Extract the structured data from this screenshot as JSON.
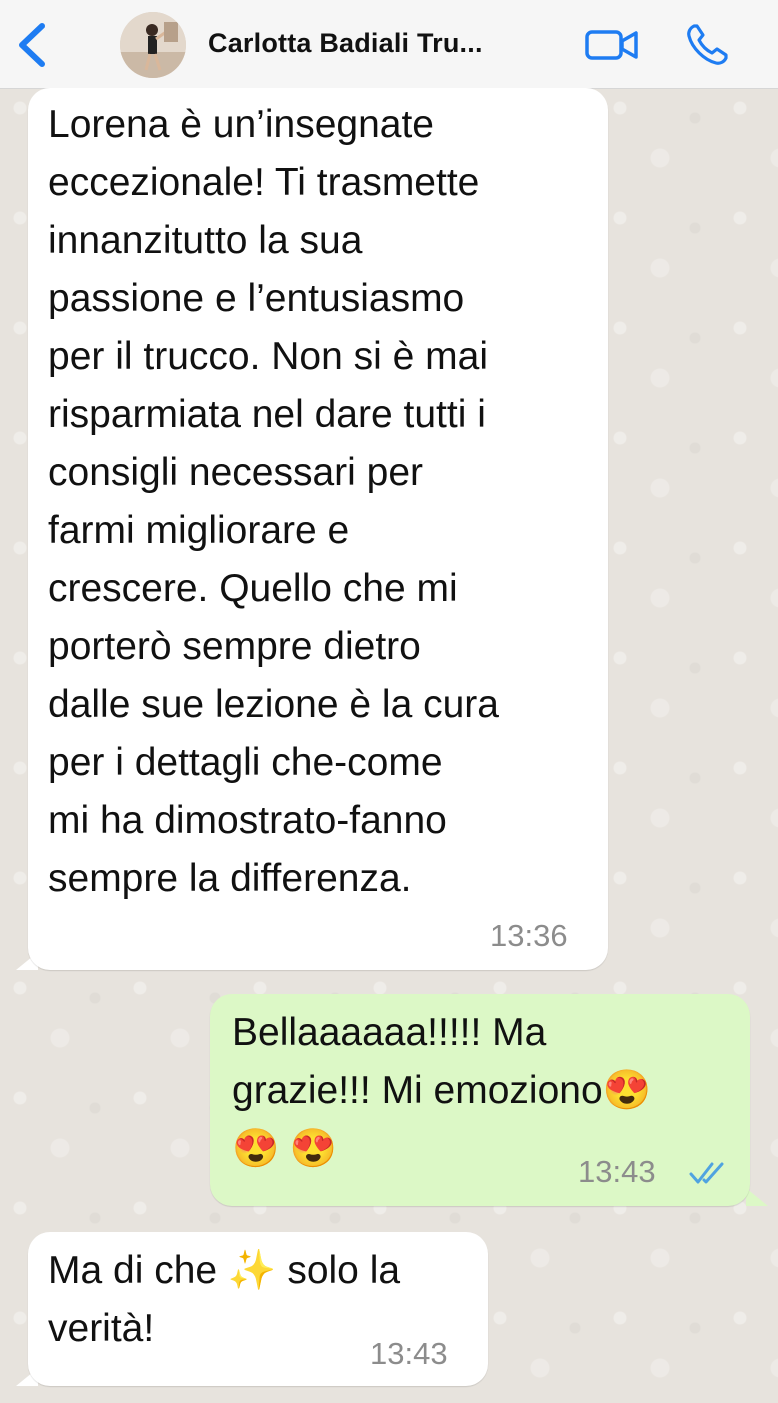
{
  "header": {
    "back_icon": "chevron-left-icon",
    "contact_name": "Carlotta Badiali Tru...",
    "video_icon": "video-camera-icon",
    "phone_icon": "phone-icon",
    "accent": "#1e7cf2"
  },
  "messages": [
    {
      "direction": "incoming",
      "lines": [
        "Lorena è un’insegnate",
        "eccezionale! Ti trasmette",
        "innanzitutto la sua",
        "passione e l’entusiasmo",
        "per il trucco. Non si è mai",
        "risparmiata nel dare tutti i",
        "consigli necessari per",
        "farmi migliorare e",
        "crescere. Quello che mi",
        "porterò sempre dietro",
        "dalle sue lezione è la cura",
        "per i dettagli che-come",
        "mi ha dimostrato-fanno",
        "sempre la differenza."
      ],
      "time": "13:36"
    },
    {
      "direction": "outgoing",
      "lines": [
        "Bellaaaaaa!!!!! Ma",
        "grazie!!! Mi emoziono😍",
        "😍 😍"
      ],
      "time": "13:43",
      "status_icon": "double-check-read-icon"
    },
    {
      "direction": "incoming",
      "lines": [
        "Ma di che ✨ solo la",
        "verità!"
      ],
      "time": "13:43"
    }
  ],
  "colors": {
    "incoming_bubble": "#ffffff",
    "outgoing_bubble": "#dcf8c6",
    "read_ticks": "#4fa3e0",
    "chat_background": "#e7e3dd"
  }
}
